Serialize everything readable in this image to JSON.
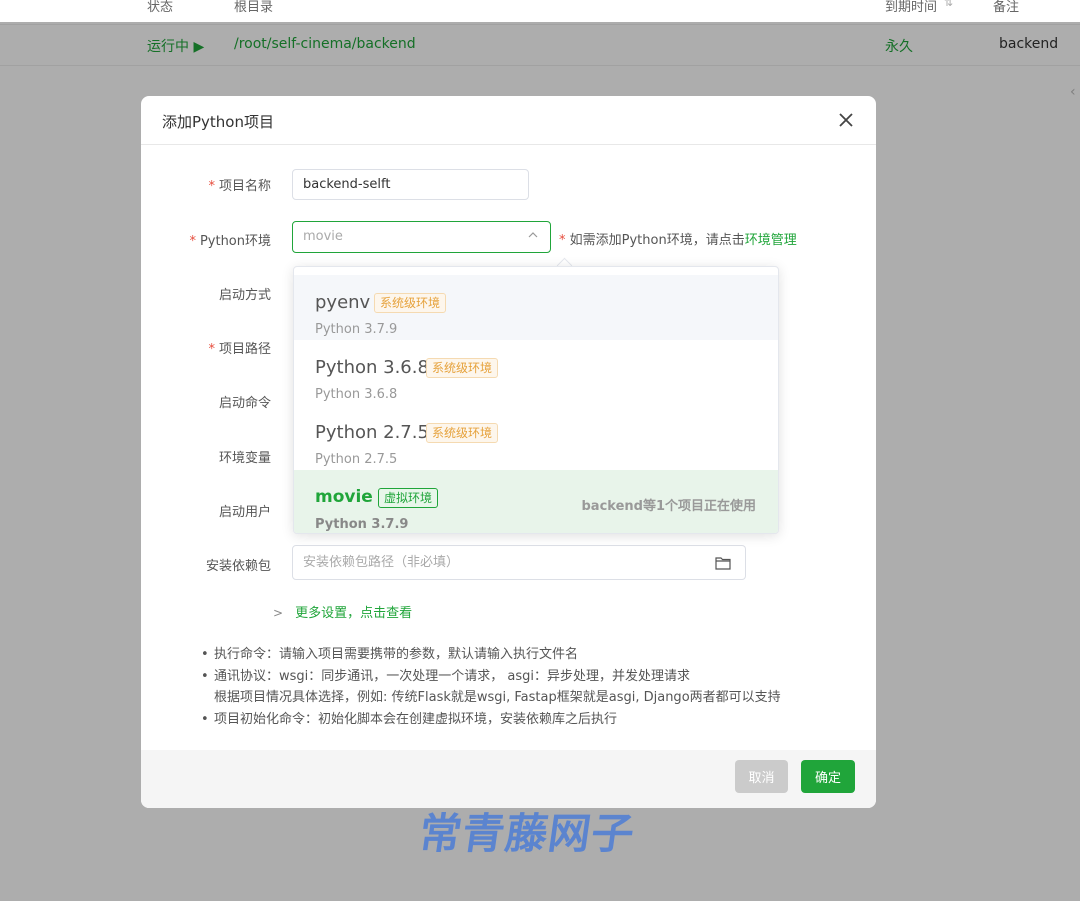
{
  "background": {
    "table_headers": {
      "status": "状态",
      "root_dir": "根目录",
      "expire": "到期时间",
      "remark": "备注"
    },
    "row": {
      "status": "运行中 ▶",
      "root_dir": "/root/self-cinema/backend",
      "expire": "永久",
      "remark": "backend"
    }
  },
  "modal": {
    "title": "添加Python项目",
    "fields": {
      "project_name": {
        "label": "项目名称",
        "value": "backend-selft",
        "required": true
      },
      "python_env": {
        "label": "Python环境",
        "placeholder": "movie",
        "required": true
      },
      "start_mode": {
        "label": "启动方式"
      },
      "project_path": {
        "label": "项目路径",
        "required": true
      },
      "start_command": {
        "label": "启动命令"
      },
      "env_vars": {
        "label": "环境变量"
      },
      "start_user": {
        "label": "启动用户"
      },
      "install_deps": {
        "label": "安装依赖包",
        "placeholder": "安装依赖包路径（非必填）"
      }
    },
    "hint": {
      "prefix": "* ",
      "text": "如需添加Python环境，请点击",
      "link": "环境管理"
    },
    "env_options": [
      {
        "name": "pyenv",
        "tag": "系统级环境",
        "version": "Python 3.7.9",
        "usage": ""
      },
      {
        "name": "Python 3.6.8",
        "tag": "系统级环境",
        "version": "Python 3.6.8",
        "usage": ""
      },
      {
        "name": "Python 2.7.5",
        "tag": "系统级环境",
        "version": "Python 2.7.5",
        "usage": ""
      },
      {
        "name": "movie",
        "tag": "虚拟环境",
        "version": "Python 3.7.9",
        "usage": "backend等1个项目正在使用"
      }
    ],
    "more_settings": "更多设置，点击查看",
    "notes": [
      "执行命令：请输入项目需要携带的参数，默认请输入执行文件名",
      "通讯协议：wsgi：同步通讯，一次处理一个请求， asgi：异步处理，并发处理请求",
      "根据项目情况具体选择，例如: 传统Flask就是wsgi, Fastap框架就是asgi, Django两者都可以支持",
      "项目初始化命令：初始化脚本会在创建虚拟环境，安装依赖库之后执行"
    ],
    "buttons": {
      "cancel": "取消",
      "ok": "确定"
    }
  },
  "watermark": "常青藤网子",
  "colors": {
    "accent": "#20a53a",
    "tag_orange": "#e6a23c",
    "required": "#e64c3c"
  },
  "icons": [
    "close-icon",
    "chevron-up-icon",
    "folder-icon",
    "chevron-right-icon",
    "sort-icon"
  ]
}
